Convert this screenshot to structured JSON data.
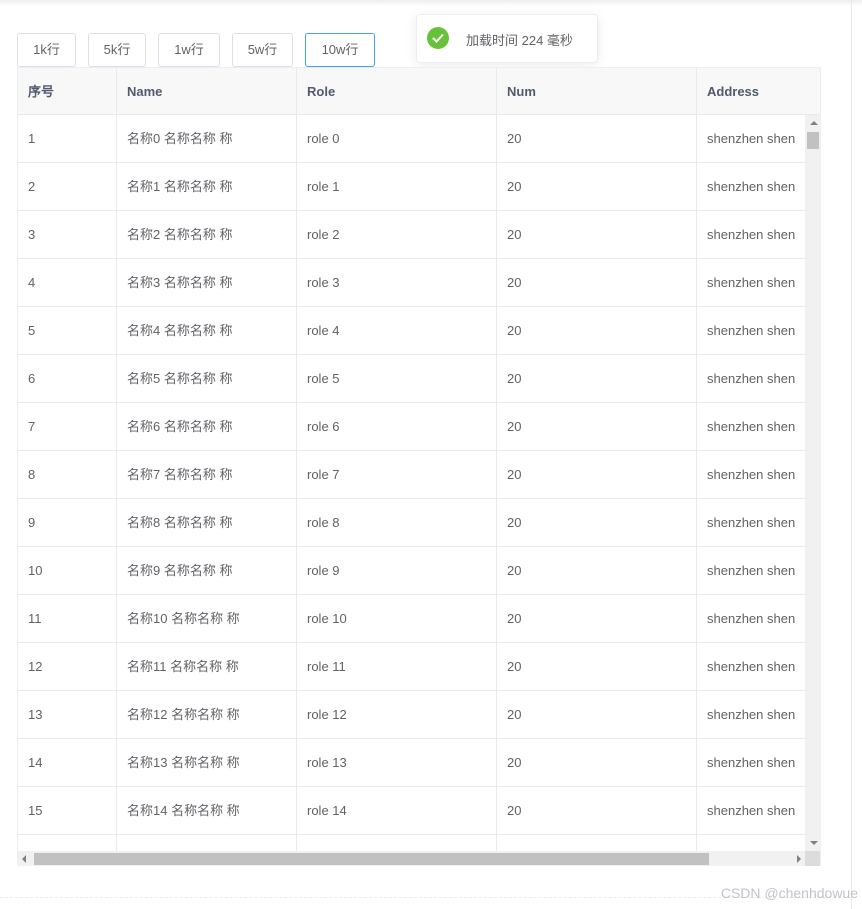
{
  "toolbar": {
    "buttons": [
      "1k行",
      "5k行",
      "1w行",
      "5w行",
      "10w行"
    ],
    "active_index": 4
  },
  "toast": {
    "message": "加载时间 224 毫秒",
    "icon": "check-circle-icon",
    "color": "#67c23a"
  },
  "table": {
    "headers": [
      "序号",
      "Name",
      "Role",
      "Num",
      "Address"
    ],
    "rows": [
      [
        "1",
        "名称0 名称名称 称",
        "role 0",
        "20",
        "shenzhen shen"
      ],
      [
        "2",
        "名称1 名称名称 称",
        "role 1",
        "20",
        "shenzhen shen"
      ],
      [
        "3",
        "名称2 名称名称 称",
        "role 2",
        "20",
        "shenzhen shen"
      ],
      [
        "4",
        "名称3 名称名称 称",
        "role 3",
        "20",
        "shenzhen shen"
      ],
      [
        "5",
        "名称4 名称名称 称",
        "role 4",
        "20",
        "shenzhen shen"
      ],
      [
        "6",
        "名称5 名称名称 称",
        "role 5",
        "20",
        "shenzhen shen"
      ],
      [
        "7",
        "名称6 名称名称 称",
        "role 6",
        "20",
        "shenzhen shen"
      ],
      [
        "8",
        "名称7 名称名称 称",
        "role 7",
        "20",
        "shenzhen shen"
      ],
      [
        "9",
        "名称8 名称名称 称",
        "role 8",
        "20",
        "shenzhen shen"
      ],
      [
        "10",
        "名称9 名称名称 称",
        "role 9",
        "20",
        "shenzhen shen"
      ],
      [
        "11",
        "名称10 名称名称 称",
        "role 10",
        "20",
        "shenzhen shen"
      ],
      [
        "12",
        "名称11 名称名称 称",
        "role 11",
        "20",
        "shenzhen shen"
      ],
      [
        "13",
        "名称12 名称名称 称",
        "role 12",
        "20",
        "shenzhen shen"
      ],
      [
        "14",
        "名称13 名称名称 称",
        "role 13",
        "20",
        "shenzhen shen"
      ],
      [
        "15",
        "名称14 名称名称 称",
        "role 14",
        "20",
        "shenzhen shen"
      ],
      [
        "",
        "",
        "",
        "",
        ""
      ]
    ]
  },
  "watermark": "CSDN @chenhdowue",
  "colors": {
    "accent": "#409eff",
    "success": "#67c23a",
    "header_bg": "#f8f8f9"
  }
}
